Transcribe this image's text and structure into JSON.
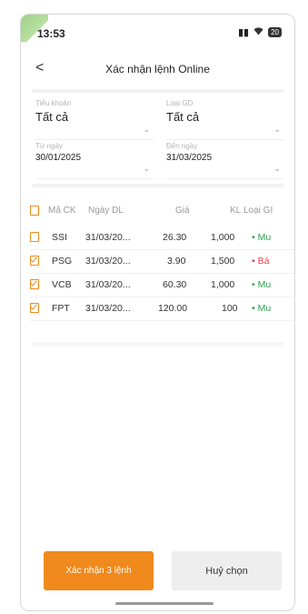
{
  "status": {
    "time": "13:53",
    "battery": "20"
  },
  "nav": {
    "back": "<",
    "title": "Xác nhận lệnh Online"
  },
  "filters": {
    "sub_account": {
      "label": "Tiểu khoản",
      "value": "Tất cả"
    },
    "trade_type": {
      "label": "Loại GD",
      "value": "Tất cả"
    },
    "from_date": {
      "label": "Từ ngày",
      "value": "30/01/2025"
    },
    "to_date": {
      "label": "Đến ngày",
      "value": "31/03/2025"
    }
  },
  "table": {
    "headers": {
      "symbol": "Mã CK",
      "date": "Ngày DL",
      "price": "Giá",
      "qty": "KL",
      "type": "Loại GI"
    },
    "rows": [
      {
        "checked": false,
        "symbol": "SSI",
        "date": "31/03/20...",
        "price": "26.30",
        "qty": "1,000",
        "type": "• Mu",
        "side": "buy"
      },
      {
        "checked": true,
        "symbol": "PSG",
        "date": "31/03/20...",
        "price": "3.90",
        "qty": "1,500",
        "type": "• Bá",
        "side": "sell"
      },
      {
        "checked": true,
        "symbol": "VCB",
        "date": "31/03/20...",
        "price": "60.30",
        "qty": "1,000",
        "type": "• Mu",
        "side": "buy"
      },
      {
        "checked": true,
        "symbol": "FPT",
        "date": "31/03/20...",
        "price": "120.00",
        "qty": "100",
        "type": "• Mu",
        "side": "buy"
      }
    ]
  },
  "buttons": {
    "confirm": "Xác nhận 3 lệnh",
    "cancel": "Huỷ chọn"
  },
  "colors": {
    "accent": "#f08a1c",
    "buy": "#2ba24c",
    "sell": "#e0424b"
  }
}
